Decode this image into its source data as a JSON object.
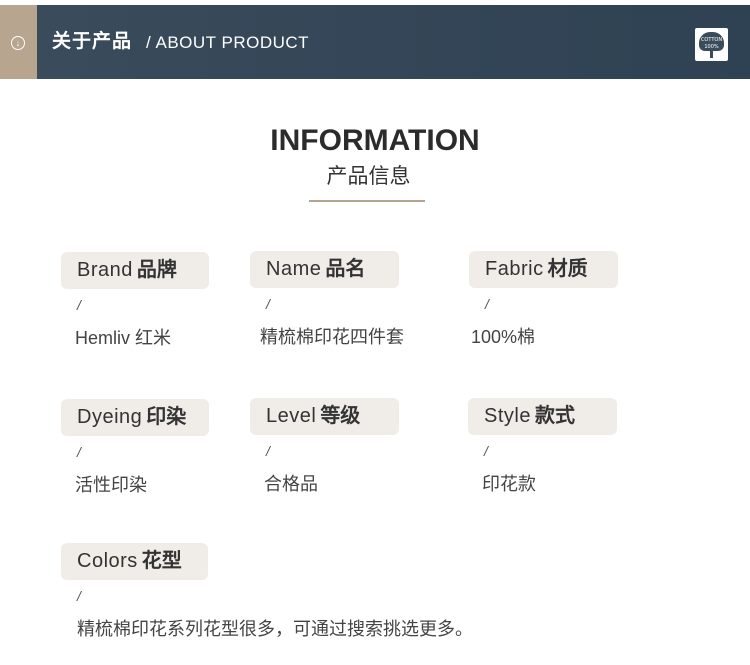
{
  "header": {
    "title_zh": "关于产品",
    "title_en": "/ ABOUT PRODUCT",
    "badge_line1": "COTTON",
    "badge_line2": "100%",
    "colors": {
      "band": "#3b4c5c",
      "accent": "#b7a58f"
    }
  },
  "section": {
    "title": "INFORMATION",
    "subtitle": "产品信息"
  },
  "fields": [
    {
      "label_en": "Brand",
      "label_zh": "品牌",
      "separator": "/",
      "value": "Hemliv 红米"
    },
    {
      "label_en": "Name",
      "label_zh": "品名",
      "separator": "/",
      "value": "精梳棉印花四件套"
    },
    {
      "label_en": "Fabric",
      "label_zh": "材质",
      "separator": "/",
      "value": "100%棉"
    },
    {
      "label_en": "Dyeing",
      "label_zh": "印染",
      "separator": "/",
      "value": "活性印染"
    },
    {
      "label_en": "Level",
      "label_zh": "等级",
      "separator": "/",
      "value": "合格品"
    },
    {
      "label_en": "Style",
      "label_zh": "款式",
      "separator": "/",
      "value": "印花款"
    },
    {
      "label_en": "Colors",
      "label_zh": "花型",
      "separator": "/",
      "value": "精梳棉印花系列花型很多，可通过搜索挑选更多。"
    }
  ]
}
